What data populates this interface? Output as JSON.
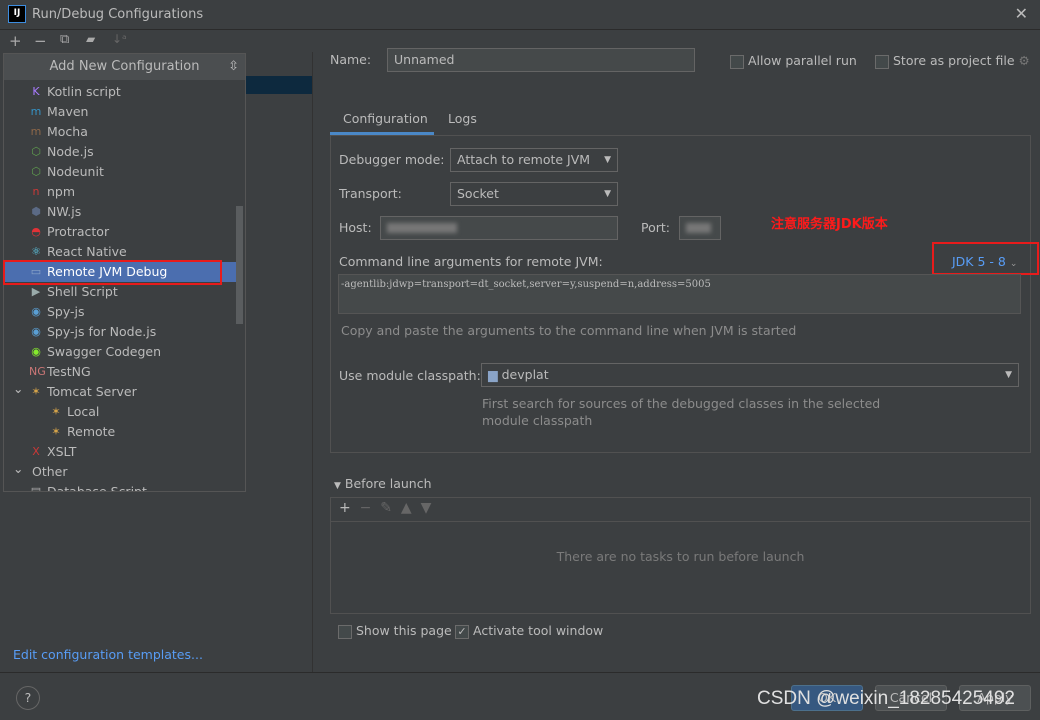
{
  "window": {
    "title": "Run/Debug Configurations",
    "logo": "IJ"
  },
  "toolbar": {
    "add": "+",
    "remove": "−",
    "copy": "⧉",
    "folder": "▰",
    "sort": "↓ᵃ"
  },
  "popup": {
    "title": "Add New Configuration",
    "items": [
      {
        "label": "Kotlin script",
        "icon": "kotlin-icon",
        "color": "#a97bff",
        "glyph": "K"
      },
      {
        "label": "Maven",
        "icon": "maven-icon",
        "color": "#3592c4",
        "glyph": "m"
      },
      {
        "label": "Mocha",
        "icon": "mocha-icon",
        "color": "#8d6748",
        "glyph": "m"
      },
      {
        "label": "Node.js",
        "icon": "nodejs-icon",
        "color": "#5fa04e",
        "glyph": "⬡"
      },
      {
        "label": "Nodeunit",
        "icon": "nodeunit-icon",
        "color": "#5fa04e",
        "glyph": "⬡"
      },
      {
        "label": "npm",
        "icon": "npm-icon",
        "color": "#cb3837",
        "glyph": "n"
      },
      {
        "label": "NW.js",
        "icon": "nwjs-icon",
        "color": "#5b6a85",
        "glyph": "⬢"
      },
      {
        "label": "Protractor",
        "icon": "protractor-icon",
        "color": "#e23237",
        "glyph": "◓"
      },
      {
        "label": "React Native",
        "icon": "react-icon",
        "color": "#61dafb",
        "glyph": "⚛"
      },
      {
        "label": "Remote JVM Debug",
        "icon": "remote-debug-icon",
        "color": "#8aa4c8",
        "glyph": "▭"
      },
      {
        "label": "Shell Script",
        "icon": "shell-icon",
        "color": "#9aa",
        "glyph": "▶"
      },
      {
        "label": "Spy-js",
        "icon": "spyjs-icon",
        "color": "#5a9fd4",
        "glyph": "◉"
      },
      {
        "label": "Spy-js for Node.js",
        "icon": "spyjs-node-icon",
        "color": "#5a9fd4",
        "glyph": "◉"
      },
      {
        "label": "Swagger Codegen",
        "icon": "swagger-icon",
        "color": "#85ea2d",
        "glyph": "◉"
      },
      {
        "label": "TestNG",
        "icon": "testng-icon",
        "color": "#c77",
        "glyph": "NG"
      },
      {
        "label": "Tomcat Server",
        "icon": "tomcat-icon",
        "color": "#d4a34a",
        "glyph": "✶"
      },
      {
        "label": "Local",
        "icon": "tomcat-local-icon",
        "color": "#d4a34a",
        "glyph": "✶"
      },
      {
        "label": "Remote",
        "icon": "tomcat-remote-icon",
        "color": "#d4a34a",
        "glyph": "✶"
      },
      {
        "label": "XSLT",
        "icon": "xslt-icon",
        "color": "#cb3837",
        "glyph": "X"
      },
      {
        "label": "Other",
        "icon": "",
        "color": "",
        "glyph": ""
      },
      {
        "label": "Database Script",
        "icon": "db-icon",
        "color": "#aaa",
        "glyph": "▤"
      }
    ]
  },
  "edit_templates": "Edit configuration templates...",
  "help": "?",
  "name": {
    "label": "Name:",
    "value": "Unnamed"
  },
  "allow_parallel": {
    "label": "Allow parallel run",
    "checked": false
  },
  "store_project": {
    "label": "Store as project file",
    "checked": false
  },
  "tabs": [
    "Configuration",
    "Logs"
  ],
  "debugger_mode": {
    "label": "Debugger mode:",
    "value": "Attach to remote JVM"
  },
  "transport": {
    "label": "Transport:",
    "value": "Socket"
  },
  "host": {
    "label": "Host:"
  },
  "port": {
    "label": "Port:"
  },
  "annotation": "注意服务器JDK版本",
  "cmdline": {
    "label": "Command line arguments for remote JVM:",
    "jdk": "JDK 5 - 8",
    "value": "-agentlib:jdwp=transport=dt_socket,server=y,suspend=n,address=5005",
    "hint": "Copy and paste the arguments to the command line when JVM is started"
  },
  "module": {
    "label": "Use module classpath:",
    "value": "devplat",
    "hint1": "First search for sources of the debugged classes in the selected",
    "hint2": "module classpath"
  },
  "before_launch": {
    "title": "Before launch",
    "empty": "There are no tasks to run before launch"
  },
  "show_page": {
    "label": "Show this page",
    "checked": false
  },
  "activate_tool": {
    "label": "Activate tool window",
    "checked": true
  },
  "buttons": {
    "ok": "OK",
    "cancel": "Cancel",
    "apply": "Apply"
  },
  "watermark": "CSDN @weixin_18285425492"
}
